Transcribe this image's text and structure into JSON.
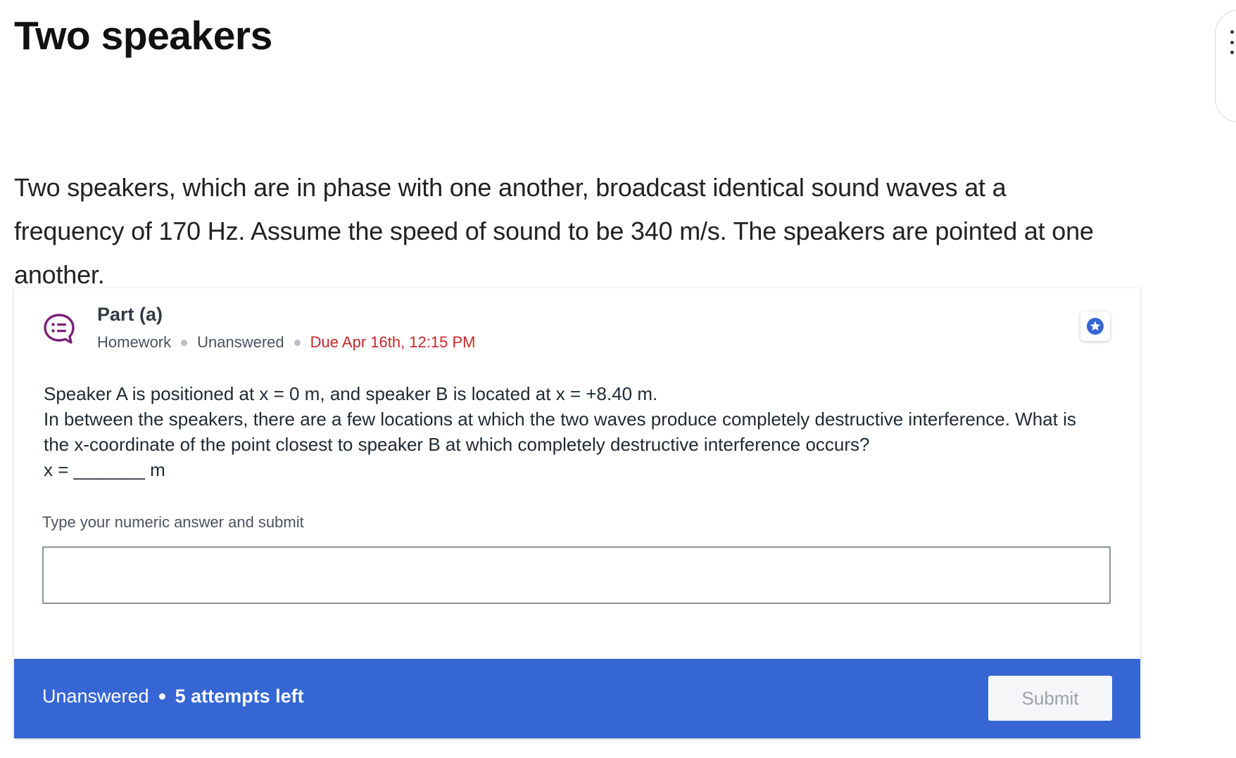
{
  "page": {
    "title": "Two speakers"
  },
  "intro": {
    "text": "Two speakers, which are in phase with one another, broadcast identical sound waves at a frequency of 170 Hz. Assume the speed of sound to be 340 m/s. The speakers are pointed at one another."
  },
  "part": {
    "title": "Part (a)",
    "type": "Homework",
    "status": "Unanswered",
    "due": "Due Apr 16th, 12:15 PM",
    "icon": "quiz-bubble-icon",
    "icon_color": "#7b1f7a",
    "due_color": "#c62828"
  },
  "question": {
    "line1": "Speaker A is positioned at x = 0 m, and speaker B is located at x = +8.40 m.",
    "line2": "In between the speakers, there are a few locations at which the two waves produce completely destructive interference. What is the x-coordinate of the point closest to speaker B at which completely destructive interference occurs?",
    "line3": "x = _______ m"
  },
  "answer": {
    "label": "Type your numeric answer and submit",
    "value": "",
    "placeholder": ""
  },
  "footer": {
    "status": "Unanswered",
    "attempts": "5 attempts left",
    "submit_label": "Submit",
    "background": "#3566d4"
  },
  "icons": {
    "star": "star-icon",
    "menu": "kebab-menu-icon"
  }
}
